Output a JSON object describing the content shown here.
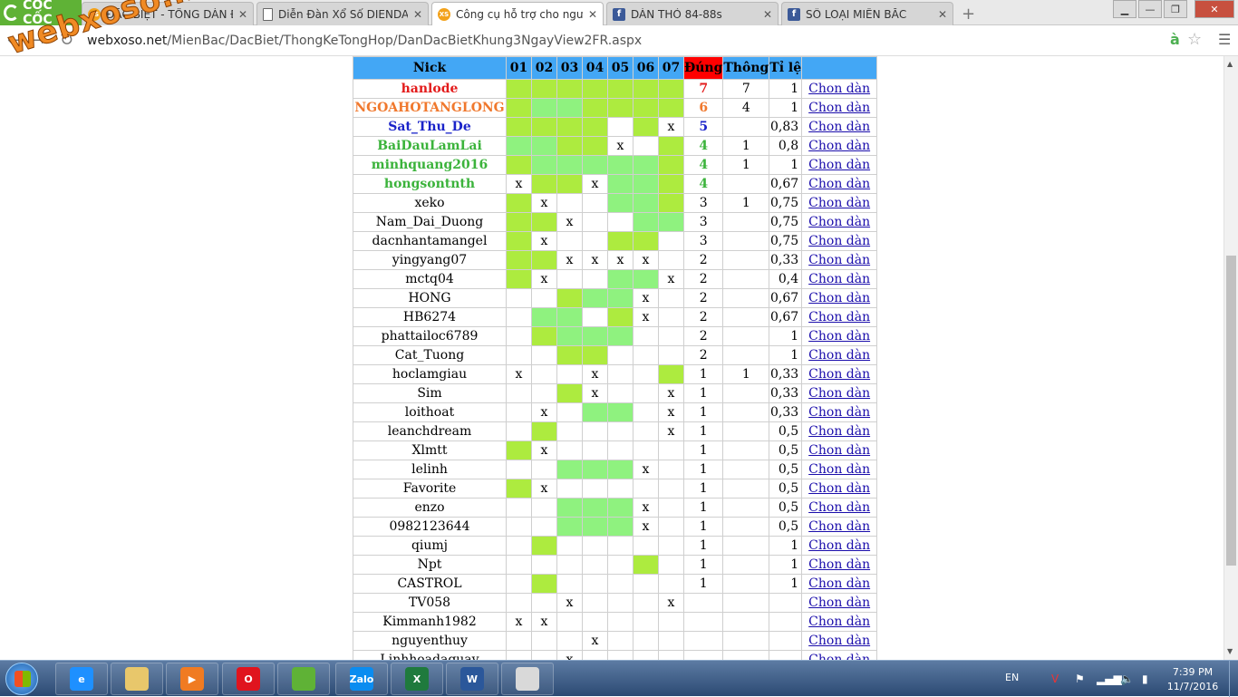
{
  "browser": {
    "name": "CỐC CỐC",
    "tabs": [
      {
        "title": "ĐẶC BIỆT - TỔNG DÀN ĐẶ",
        "icon": "xs"
      },
      {
        "title": "Diễn Đàn Xổ Số DIENDAN",
        "icon": "page"
      },
      {
        "title": "Công cụ hỗ trợ cho người",
        "icon": "xs",
        "active": true
      },
      {
        "title": "DÀN THỎ 84-88s",
        "icon": "fb"
      },
      {
        "title": "SỐ LOẠI MIỀN BẮC",
        "icon": "fb"
      }
    ],
    "url_host": "webxoso.net",
    "url_path": "/MienBac/DacBiet/ThongKeTongHop/DanDacBietKhung3NgayView2FR.aspx",
    "watermark": "webxoso.net"
  },
  "table": {
    "headers": {
      "nick": "Nick",
      "days": [
        "01",
        "02",
        "03",
        "04",
        "05",
        "06",
        "07"
      ],
      "dung": "Đúng",
      "thong": "Thông",
      "tile": "Tỉ lệ",
      "link": ""
    },
    "link_label": "Chon dàn",
    "rows": [
      {
        "nick": "hanlode",
        "color": "#e31b1b",
        "bold": true,
        "cells": [
          "g1",
          "g1",
          "g1",
          "g1",
          "g1",
          "g1",
          "g1"
        ],
        "dung": "7",
        "thong": "7",
        "tile": "1"
      },
      {
        "nick": "NGOAHOTANGLONG",
        "color": "#f0782d",
        "bold": true,
        "cells": [
          "g1",
          "g2",
          "g2",
          "g1",
          "g1",
          "g1",
          "g1"
        ],
        "dung": "6",
        "thong": "4",
        "tile": "1"
      },
      {
        "nick": "Sat_Thu_De",
        "color": "#1a23c9",
        "bold": true,
        "cells": [
          "g1",
          "g1",
          "g1",
          "g1",
          "",
          "g1",
          "x"
        ],
        "dung": "5",
        "thong": "",
        "tile": "0,83"
      },
      {
        "nick": "BaiDauLamLai",
        "color": "#3bb33b",
        "bold": true,
        "cells": [
          "g2",
          "g2",
          "g1",
          "g1",
          "x",
          "",
          "g1"
        ],
        "dung": "4",
        "thong": "1",
        "tile": "0,8"
      },
      {
        "nick": "minhquang2016",
        "color": "#3bb33b",
        "bold": true,
        "cells": [
          "g1",
          "g2",
          "g2",
          "g2",
          "g2",
          "g2",
          "g1"
        ],
        "dung": "4",
        "thong": "1",
        "tile": "1"
      },
      {
        "nick": "hongsontnth",
        "color": "#3bb33b",
        "bold": true,
        "cells": [
          "x",
          "g1",
          "g1",
          "x",
          "g2",
          "g2",
          "g1"
        ],
        "dung": "4",
        "thong": "",
        "tile": "0,67"
      },
      {
        "nick": "xeko",
        "cells": [
          "g1",
          "x",
          "",
          "",
          "g2",
          "g2",
          "g1"
        ],
        "dung": "3",
        "thong": "1",
        "tile": "0,75"
      },
      {
        "nick": "Nam_Dai_Duong",
        "cells": [
          "g1",
          "g1",
          "x",
          "",
          "",
          "g2",
          "g2"
        ],
        "dung": "3",
        "thong": "",
        "tile": "0,75"
      },
      {
        "nick": "dacnhantamangel",
        "cells": [
          "g1",
          "x",
          "",
          "",
          "g1",
          "g1",
          ""
        ],
        "dung": "3",
        "thong": "",
        "tile": "0,75"
      },
      {
        "nick": "yingyang07",
        "cells": [
          "g1",
          "g1",
          "x",
          "x",
          "x",
          "x",
          ""
        ],
        "dung": "2",
        "thong": "",
        "tile": "0,33"
      },
      {
        "nick": "mctq04",
        "cells": [
          "g1",
          "x",
          "",
          "",
          "g2",
          "g2",
          "x"
        ],
        "dung": "2",
        "thong": "",
        "tile": "0,4"
      },
      {
        "nick": "HONG",
        "cells": [
          "",
          "",
          "g1",
          "g2",
          "g2",
          "x",
          ""
        ],
        "dung": "2",
        "thong": "",
        "tile": "0,67"
      },
      {
        "nick": "HB6274",
        "cells": [
          "",
          "g2",
          "g2",
          "",
          "g1",
          "x",
          ""
        ],
        "dung": "2",
        "thong": "",
        "tile": "0,67"
      },
      {
        "nick": "phattailoc6789",
        "cells": [
          "",
          "g1",
          "g2",
          "g2",
          "g2",
          "",
          ""
        ],
        "dung": "2",
        "thong": "",
        "tile": "1"
      },
      {
        "nick": "Cat_Tuong",
        "cells": [
          "",
          "",
          "g1",
          "g1",
          "",
          "",
          ""
        ],
        "dung": "2",
        "thong": "",
        "tile": "1"
      },
      {
        "nick": "hoclamgiau",
        "cells": [
          "x",
          "",
          "",
          "x",
          "",
          "",
          "g1"
        ],
        "dung": "1",
        "thong": "1",
        "tile": "0,33"
      },
      {
        "nick": "Sim",
        "cells": [
          "",
          "",
          "g1",
          "x",
          "",
          "",
          "x"
        ],
        "dung": "1",
        "thong": "",
        "tile": "0,33"
      },
      {
        "nick": "loithoat",
        "cells": [
          "",
          "x",
          "",
          "g2",
          "g2",
          "",
          "x"
        ],
        "dung": "1",
        "thong": "",
        "tile": "0,33"
      },
      {
        "nick": "leanchdream",
        "cells": [
          "",
          "g1",
          "",
          "",
          "",
          "",
          "x"
        ],
        "dung": "1",
        "thong": "",
        "tile": "0,5"
      },
      {
        "nick": "Xlmtt",
        "cells": [
          "g1",
          "x",
          "",
          "",
          "",
          "",
          ""
        ],
        "dung": "1",
        "thong": "",
        "tile": "0,5"
      },
      {
        "nick": "lelinh",
        "cells": [
          "",
          "",
          "g2",
          "g2",
          "g2",
          "x",
          ""
        ],
        "dung": "1",
        "thong": "",
        "tile": "0,5"
      },
      {
        "nick": "Favorite",
        "cells": [
          "g1",
          "x",
          "",
          "",
          "",
          "",
          ""
        ],
        "dung": "1",
        "thong": "",
        "tile": "0,5"
      },
      {
        "nick": "enzo",
        "cells": [
          "",
          "",
          "g2",
          "g2",
          "g2",
          "x",
          ""
        ],
        "dung": "1",
        "thong": "",
        "tile": "0,5"
      },
      {
        "nick": "0982123644",
        "cells": [
          "",
          "",
          "g2",
          "g2",
          "g2",
          "x",
          ""
        ],
        "dung": "1",
        "thong": "",
        "tile": "0,5"
      },
      {
        "nick": "qiumj",
        "cells": [
          "",
          "g1",
          "",
          "",
          "",
          "",
          ""
        ],
        "dung": "1",
        "thong": "",
        "tile": "1"
      },
      {
        "nick": "Npt",
        "cells": [
          "",
          "",
          "",
          "",
          "",
          "g1",
          ""
        ],
        "dung": "1",
        "thong": "",
        "tile": "1"
      },
      {
        "nick": "CASTROL",
        "cells": [
          "",
          "g1",
          "",
          "",
          "",
          "",
          ""
        ],
        "dung": "1",
        "thong": "",
        "tile": "1"
      },
      {
        "nick": "TV058",
        "cells": [
          "",
          "",
          "x",
          "",
          "",
          "",
          "x"
        ],
        "dung": "",
        "thong": "",
        "tile": ""
      },
      {
        "nick": "Kimmanh1982",
        "cells": [
          "x",
          "x",
          "",
          "",
          "",
          "",
          ""
        ],
        "dung": "",
        "thong": "",
        "tile": ""
      },
      {
        "nick": "nguyenthuy",
        "cells": [
          "",
          "",
          "",
          "x",
          "",
          "",
          ""
        ],
        "dung": "",
        "thong": "",
        "tile": ""
      },
      {
        "nick": "Linhhoadaquay",
        "cells": [
          "",
          "",
          "x",
          "",
          "",
          "",
          ""
        ],
        "dung": "",
        "thong": "",
        "tile": ""
      }
    ]
  },
  "colors": {
    "header_bg": "#43a7f5",
    "dung_header_bg": "#ff0000",
    "green_1": "#adeb3f",
    "green_2": "#8ff27f",
    "link": "#1a0dab"
  },
  "taskbar": {
    "apps": [
      {
        "name": "internet-explorer",
        "label": "e",
        "color": "#1e90ff"
      },
      {
        "name": "file-explorer",
        "label": "",
        "color": "#e8c76b"
      },
      {
        "name": "media-player",
        "label": "▶",
        "color": "#f07b22"
      },
      {
        "name": "opera",
        "label": "O",
        "color": "#e0141e"
      },
      {
        "name": "coccoc",
        "label": "",
        "color": "#5fb236"
      },
      {
        "name": "zalo",
        "label": "Zalo",
        "color": "#0a8cf0"
      },
      {
        "name": "excel",
        "label": "X",
        "color": "#1f7a3d"
      },
      {
        "name": "word",
        "label": "W",
        "color": "#2b579a"
      },
      {
        "name": "paint",
        "label": "",
        "color": "#d9d9d9"
      }
    ],
    "language": "EN",
    "time": "7:39 PM",
    "date": "11/7/2016"
  }
}
